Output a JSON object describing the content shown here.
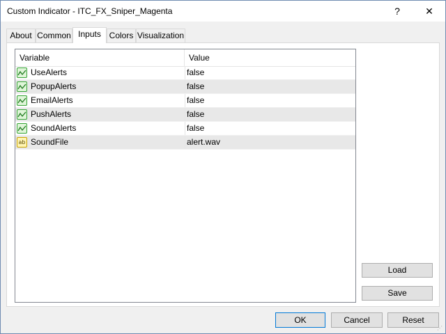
{
  "window": {
    "title": "Custom Indicator - ITC_FX_Sniper_Magenta",
    "help_label": "?",
    "close_label": "✕"
  },
  "tabs": [
    {
      "label": "About"
    },
    {
      "label": "Common"
    },
    {
      "label": "Inputs",
      "active": true
    },
    {
      "label": "Colors"
    },
    {
      "label": "Visualization"
    }
  ],
  "table": {
    "columns": [
      "Variable",
      "Value"
    ],
    "rows": [
      {
        "icon": "bool-parameter-icon",
        "variable": "UseAlerts",
        "value": "false"
      },
      {
        "icon": "bool-parameter-icon",
        "variable": "PopupAlerts",
        "value": "false"
      },
      {
        "icon": "bool-parameter-icon",
        "variable": "EmailAlerts",
        "value": "false"
      },
      {
        "icon": "bool-parameter-icon",
        "variable": "PushAlerts",
        "value": "false"
      },
      {
        "icon": "bool-parameter-icon",
        "variable": "SoundAlerts",
        "value": "false"
      },
      {
        "icon": "string-parameter-icon",
        "variable": "SoundFile",
        "value": "alert.wav",
        "icon_text": "ab"
      }
    ]
  },
  "side_buttons": {
    "load_label": "Load",
    "save_label": "Save"
  },
  "footer": {
    "ok_label": "OK",
    "cancel_label": "Cancel",
    "reset_label": "Reset"
  },
  "colors": {
    "accent_border": "#0078d7",
    "bool_icon_green": "#37a537",
    "string_icon_yellow": "#fff5b3",
    "alt_row": "#e8e8e8"
  }
}
